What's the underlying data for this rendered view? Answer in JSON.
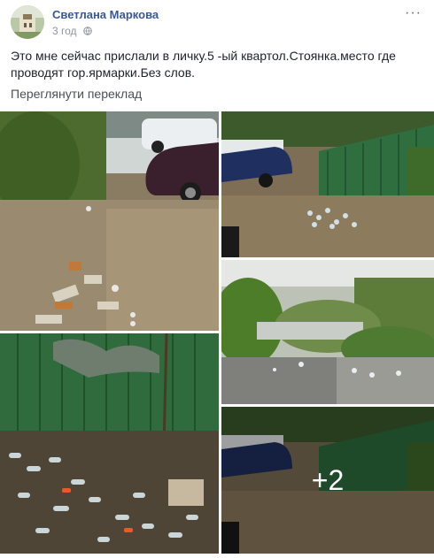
{
  "post": {
    "author": "Светлана Маркова",
    "time": "3 год",
    "more_label": "···",
    "text": "Это мне сейчас прислали в личку.5 -ый квартол.Стоянка.место где проводят гор.ярмарки.Без слов.",
    "translate_label": "Переглянути переклад",
    "photos": {
      "more_count": "+2"
    },
    "icons": {
      "avatar": "avatar",
      "privacy": "globe-icon",
      "menu": "more-options-icon"
    }
  }
}
